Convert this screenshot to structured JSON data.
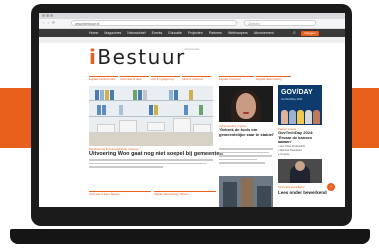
{
  "colors": {
    "accent": "#e8601c",
    "background": "#ffffff",
    "device": "#1b1b1b",
    "nav": "#3a3a3a"
  },
  "browser": {
    "url": "www.ibestuur.nl",
    "search_placeholder": "Zoeken",
    "nav_icons": "‹ › ⟳"
  },
  "site": {
    "logo_prefix": "i",
    "logo_rest": "Bestuur",
    "menu": [
      "Home",
      "Magazines",
      "Nieuwsbrief",
      "Events",
      "Educatie",
      "Projecten",
      "Partners",
      "Webinarpers",
      "Abonnement"
    ],
    "search_icon": "⌕",
    "cta_label": "Inloggen",
    "ad_label": "Advertentie"
  },
  "categories": [
    "Digitale transformatie",
    "Informatie & data",
    "Wet & regelgeving",
    "Slimme overheid",
    "Digitale Overheid",
    "Digitale data-sharing"
  ],
  "main_article": {
    "meta": "Digitalisering & Automatisering | Nieuws",
    "headline": "Uitvoering Woo gaat nog niet soepel bij gemeenten"
  },
  "middle_article": {
    "meta": "Cybersecurity | Opinie",
    "headline": "'Gebrek de tools om gemeentelijke zaar te stabiel'"
  },
  "sidebar": {
    "banner_title": "GOV/DAY",
    "banner_subtitle": "GovTechDay 2024",
    "meta": "Partner events",
    "headline": "GovTechDay 2024: 'Ervaar de kansen samen'",
    "list": [
      "▪ Events",
      "▪ Gov Shop ProductInfo",
      "▪ Webinar Download",
      "▪ Congres"
    ],
    "meta2": "Informatie beveiliging",
    "headline2": "Lees onder bewerkend"
  },
  "bottom_row": [
    {
      "meta": "Informatie & data | Nieuws"
    },
    {
      "meta": "Digitale data-sharing | Nieuws"
    }
  ],
  "chat_icon": "›"
}
